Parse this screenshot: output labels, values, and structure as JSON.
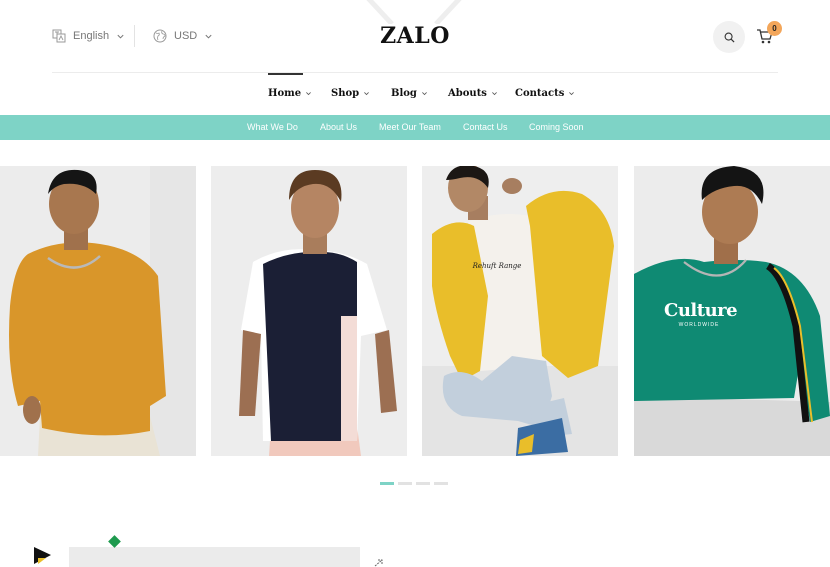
{
  "header": {
    "language": "English",
    "currency": "USD",
    "logo": "ZALO",
    "cart_count": "0",
    "icons": {
      "language": "translate-icon",
      "currency": "globe-icon",
      "search": "search-icon",
      "cart": "cart-icon"
    }
  },
  "main_nav": {
    "items": [
      {
        "label": "Home",
        "active": true
      },
      {
        "label": "Shop"
      },
      {
        "label": "Blog"
      },
      {
        "label": "Abouts"
      },
      {
        "label": "Contacts"
      }
    ]
  },
  "sub_nav": {
    "items": [
      "What We Do",
      "About Us",
      "Meet Our Team",
      "Contact Us",
      "Coming Soon"
    ]
  },
  "slider": {
    "slides": [
      {
        "title": "",
        "tshirt_text": ""
      },
      {
        "title": ""
      },
      {
        "title": "",
        "tshirt_text": "Rehuft Range"
      },
      {
        "title": "",
        "tshirt_text": "Culture",
        "tshirt_subtext": "WORLDWIDE"
      }
    ],
    "dot_count": 4,
    "active_dot": 0
  },
  "colors": {
    "accent": "#7ed3c6",
    "badge": "#f3a65a",
    "mustard": "#d9962a",
    "yellow": "#e9be2a",
    "teal": "#0f8a73",
    "navy": "#1b1f35",
    "green": "#1e9a4e"
  }
}
